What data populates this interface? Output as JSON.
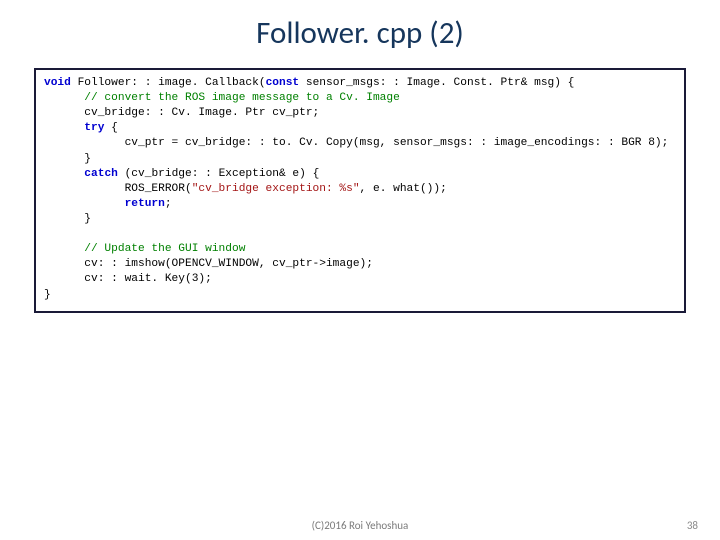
{
  "title": "Follower. cpp (2)",
  "code": {
    "l1a": "void",
    "l1b": " Follower: : image. Callback(",
    "l1c": "const",
    "l1d": " sensor_msgs: : Image. Const. Ptr& msg) {",
    "l2": "      // convert the ROS image message to a Cv. Image",
    "l3": "      cv_bridge: : Cv. Image. Ptr cv_ptr;",
    "l4a": "      ",
    "l4b": "try",
    "l4c": " {",
    "l5": "            cv_ptr = cv_bridge: : to. Cv. Copy(msg, sensor_msgs: : image_encodings: : BGR 8);",
    "l6": "      }",
    "l7a": "      ",
    "l7b": "catch",
    "l7c": " (cv_bridge: : Exception& e) {",
    "l8a": "            ROS_ERROR(",
    "l8b": "\"cv_bridge exception: %s\"",
    "l8c": ", e. what());",
    "l9a": "            ",
    "l9b": "return",
    "l9c": ";",
    "l10": "      }",
    "blank1": "",
    "l11": "      // Update the GUI window",
    "l12": "      cv: : imshow(OPENCV_WINDOW, cv_ptr->image);",
    "l13": "      cv: : wait. Key(3);",
    "l14": "}"
  },
  "footer": {
    "center": "(C)2016 Roi Yehoshua",
    "page": "38"
  }
}
